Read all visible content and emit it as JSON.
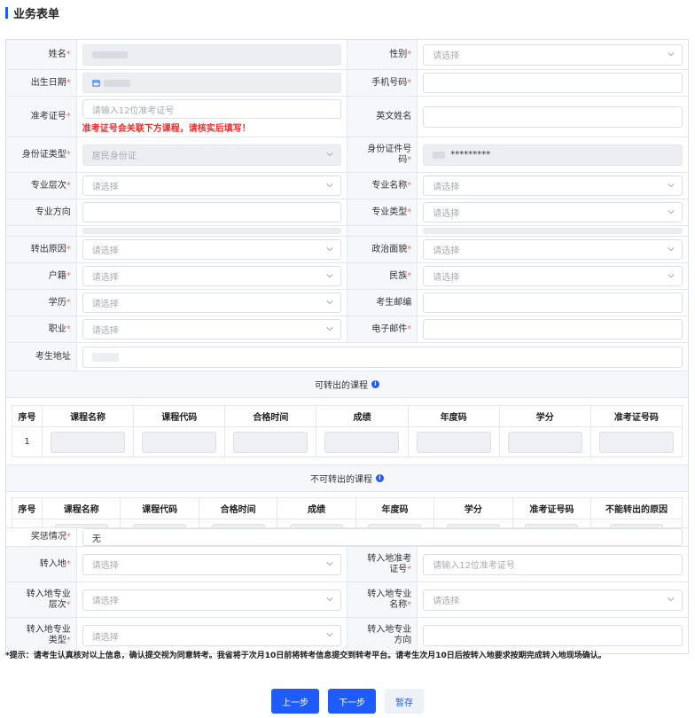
{
  "title": "业务表单",
  "placeholders": {
    "select": "请选择",
    "exam_no": "请输入12位准考证号",
    "id_masked": "*********"
  },
  "fields": {
    "name": "姓名",
    "gender": "性别",
    "birth": "出生日期",
    "phone": "手机号码",
    "exam_no": "准考证号",
    "english_name": "英文姓名",
    "exam_warning": "准考证号会关联下方课程，请核实后填写！",
    "id_type": "身份证类型",
    "id_type_value": "居民身份证",
    "id_no_line1": "身份证件号",
    "id_no_line2": "码",
    "major_level": "专业层次",
    "major_name": "专业名称",
    "major_direction": "专业方向",
    "major_type": "专业类型",
    "transfer_reason": "转出原因",
    "political": "政治面貌",
    "household": "户籍",
    "ethnicity": "民族",
    "education": "学历",
    "postcode": "考生邮编",
    "occupation": "职业",
    "email": "电子邮件",
    "address": "考生地址",
    "award_label": "奖惩情况",
    "award_value": "无",
    "transfer_to": "转入地",
    "to_exam_no_line1": "转入地准考",
    "to_exam_no_line2": "证号",
    "to_level_line1": "转入地专业",
    "to_level_line2": "层次",
    "to_name_line1": "转入地专业",
    "to_name_line2": "名称",
    "to_type_line1": "转入地专业",
    "to_type_line2": "类型",
    "to_dir_line1": "转入地专业",
    "to_dir_line2": "方向"
  },
  "transferable": {
    "title": "可转出的课程",
    "columns": [
      "序号",
      "课程名称",
      "课程代码",
      "合格时间",
      "成绩",
      "年度码",
      "学分",
      "准考证号码"
    ],
    "row_index": "1"
  },
  "non_transferable": {
    "title": "不可转出的课程",
    "columns": [
      "序号",
      "课程名称",
      "课程代码",
      "合格时间",
      "成绩",
      "年度码",
      "学分",
      "准考证号码",
      "不能转出的原因"
    ]
  },
  "tip": "*提示：请考生认真核对以上信息，确认提交视为同意转考。我省将于次月10日前将转考信息提交到转考平台。请考生次月10日后按转入地要求按期完成转入地现场确认。",
  "buttons": {
    "prev": "上一步",
    "next": "下一步",
    "save": "暂存"
  },
  "colors": {
    "accent": "#1e5cff",
    "required": "#f56c6c",
    "warning": "#f52b2b"
  },
  "icons": [
    "calendar-icon",
    "chevron-down-icon",
    "info-icon"
  ]
}
